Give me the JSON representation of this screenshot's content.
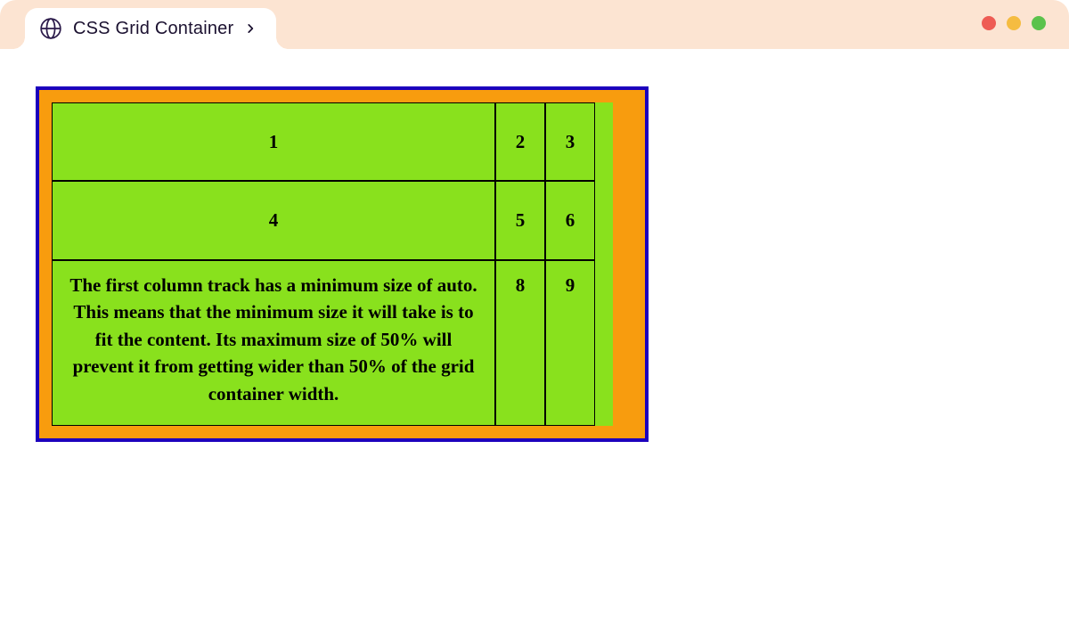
{
  "tab": {
    "title": "CSS Grid Container"
  },
  "grid": {
    "cells": {
      "c1": "1",
      "c2": "2",
      "c3": "3",
      "c4": "4",
      "c5": "5",
      "c6": "6",
      "c7": "The first column track has a minimum size of auto. This means that the minimum size it will take is to fit the content. Its maximum size of 50% will prevent it from getting wider than 50% of the grid container width.",
      "c8": "8",
      "c9": "9"
    }
  }
}
